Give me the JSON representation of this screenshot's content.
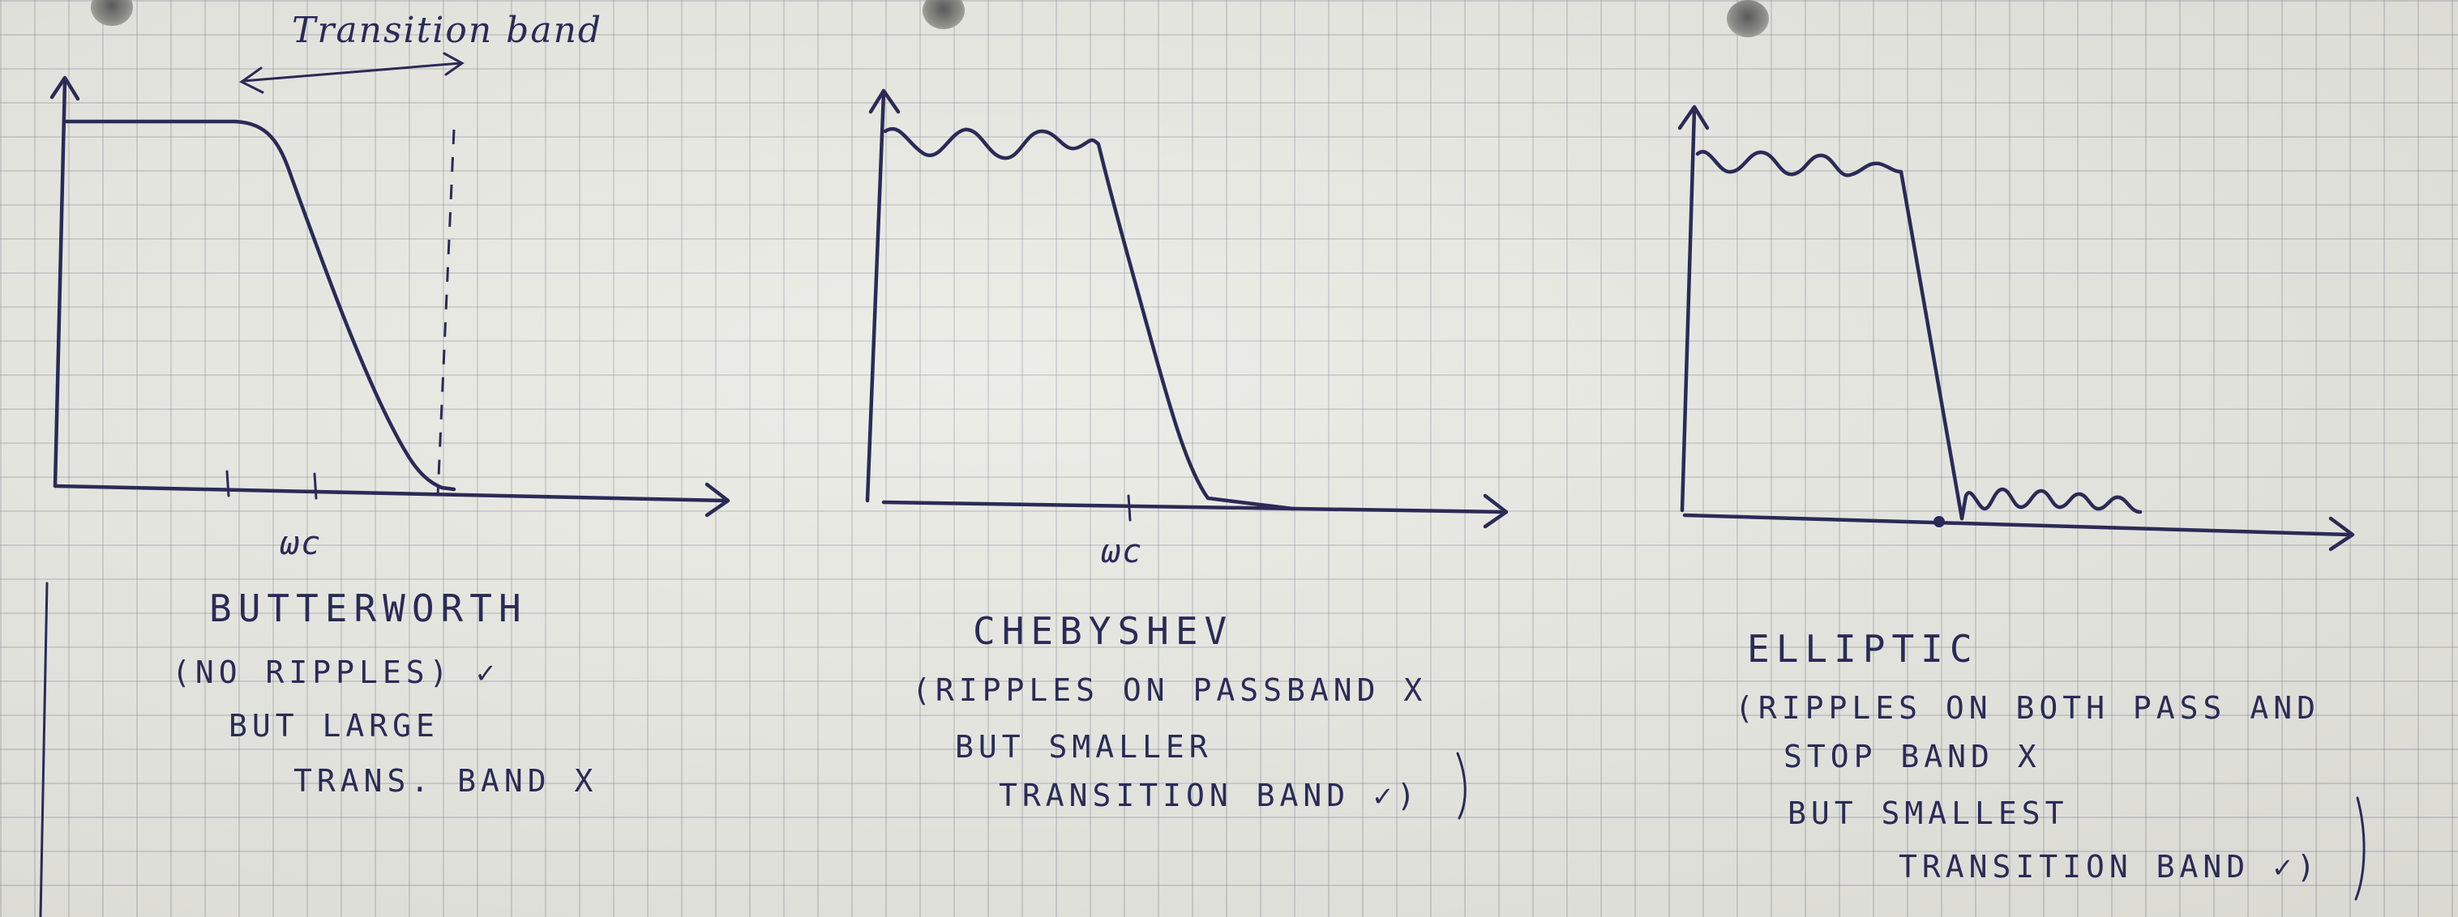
{
  "annotations": {
    "transition_band": "Transition band"
  },
  "panels": [
    {
      "title": "BUTTERWORTH",
      "axis_label": "ωc",
      "notes": [
        "(NO RIPPLES) ✓",
        "BUT LARGE",
        "TRANS. BAND X"
      ]
    },
    {
      "title": "CHEBYSHEV",
      "axis_label": "ωc",
      "notes": [
        "(RIPPLES ON PASSBAND X",
        "BUT SMALLER",
        "TRANSITION BAND ✓)"
      ]
    },
    {
      "title": "ELLIPTIC",
      "axis_label": "",
      "notes": [
        "(RIPPLES ON BOTH PASS AND",
        "STOP BAND X",
        "BUT SMALLEST",
        "TRANSITION BAND ✓)"
      ]
    }
  ]
}
